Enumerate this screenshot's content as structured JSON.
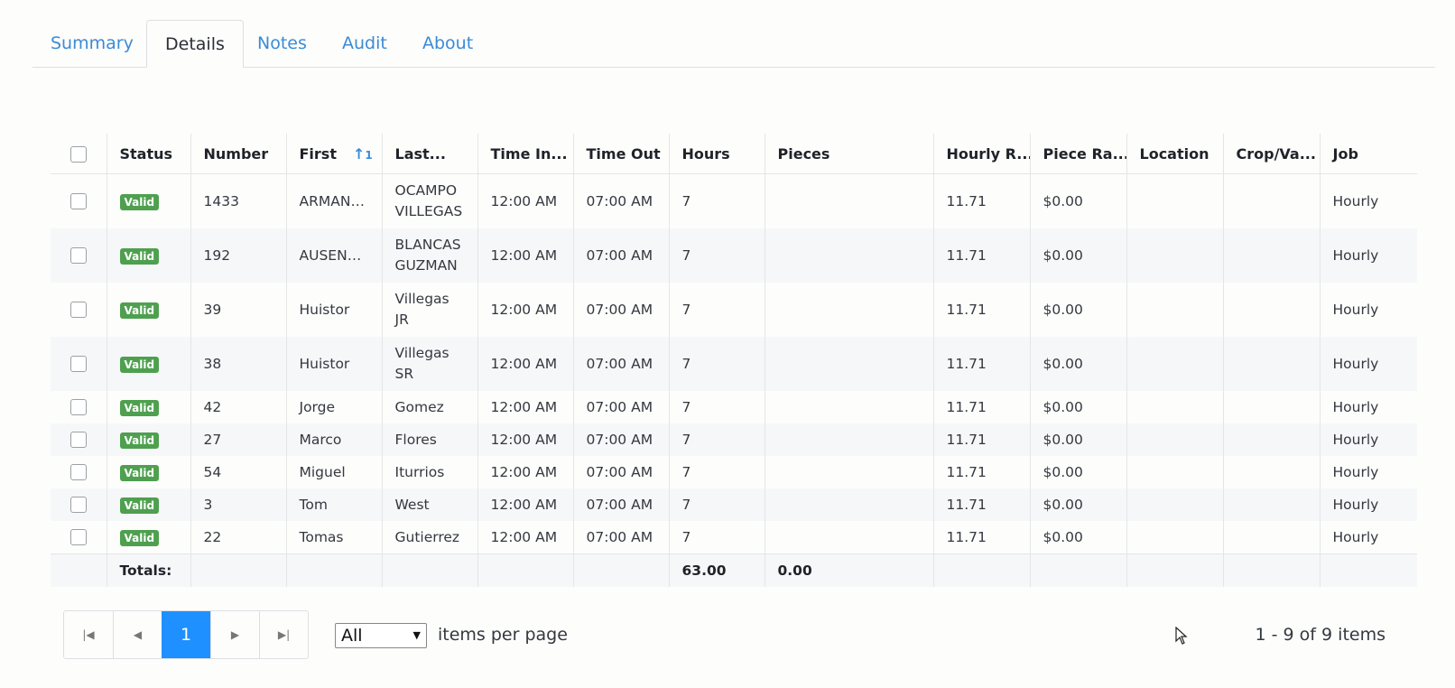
{
  "tabs": [
    {
      "label": "Summary",
      "active": false
    },
    {
      "label": "Details",
      "active": true
    },
    {
      "label": "Notes",
      "active": false
    },
    {
      "label": "Audit",
      "active": false
    },
    {
      "label": "About",
      "active": false
    }
  ],
  "grid": {
    "columns": [
      "Status",
      "Number",
      "First",
      "Last...",
      "Time In...",
      "Time Out",
      "Hours",
      "Pieces",
      "Hourly R...",
      "Piece Ra...",
      "Location",
      "Crop/Va...",
      "Job"
    ],
    "sort": {
      "column": "First",
      "direction": "ascending",
      "order": "1"
    },
    "rows": [
      {
        "status": "Valid",
        "number": "1433",
        "first": "ARMAND...",
        "last": [
          "OCAMPO",
          "VILLEGAS"
        ],
        "time_in": "12:00 AM",
        "time_out": "07:00 AM",
        "hours": "7",
        "pieces": "",
        "hourly_rate": "11.71",
        "piece_rate": "$0.00",
        "location": "",
        "crop": "",
        "job": "Hourly"
      },
      {
        "status": "Valid",
        "number": "192",
        "first": "AUSENCI...",
        "last": [
          "BLANCAS",
          "GUZMAN"
        ],
        "time_in": "12:00 AM",
        "time_out": "07:00 AM",
        "hours": "7",
        "pieces": "",
        "hourly_rate": "11.71",
        "piece_rate": "$0.00",
        "location": "",
        "crop": "",
        "job": "Hourly"
      },
      {
        "status": "Valid",
        "number": "39",
        "first": "Huistor",
        "last": [
          "Villegas",
          "JR"
        ],
        "time_in": "12:00 AM",
        "time_out": "07:00 AM",
        "hours": "7",
        "pieces": "",
        "hourly_rate": "11.71",
        "piece_rate": "$0.00",
        "location": "",
        "crop": "",
        "job": "Hourly"
      },
      {
        "status": "Valid",
        "number": "38",
        "first": "Huistor",
        "last": [
          "Villegas",
          "SR"
        ],
        "time_in": "12:00 AM",
        "time_out": "07:00 AM",
        "hours": "7",
        "pieces": "",
        "hourly_rate": "11.71",
        "piece_rate": "$0.00",
        "location": "",
        "crop": "",
        "job": "Hourly"
      },
      {
        "status": "Valid",
        "number": "42",
        "first": "Jorge",
        "last": [
          "Gomez"
        ],
        "time_in": "12:00 AM",
        "time_out": "07:00 AM",
        "hours": "7",
        "pieces": "",
        "hourly_rate": "11.71",
        "piece_rate": "$0.00",
        "location": "",
        "crop": "",
        "job": "Hourly"
      },
      {
        "status": "Valid",
        "number": "27",
        "first": "Marco",
        "last": [
          "Flores"
        ],
        "time_in": "12:00 AM",
        "time_out": "07:00 AM",
        "hours": "7",
        "pieces": "",
        "hourly_rate": "11.71",
        "piece_rate": "$0.00",
        "location": "",
        "crop": "",
        "job": "Hourly"
      },
      {
        "status": "Valid",
        "number": "54",
        "first": "Miguel",
        "last": [
          "Iturrios"
        ],
        "time_in": "12:00 AM",
        "time_out": "07:00 AM",
        "hours": "7",
        "pieces": "",
        "hourly_rate": "11.71",
        "piece_rate": "$0.00",
        "location": "",
        "crop": "",
        "job": "Hourly"
      },
      {
        "status": "Valid",
        "number": "3",
        "first": "Tom",
        "last": [
          "West"
        ],
        "time_in": "12:00 AM",
        "time_out": "07:00 AM",
        "hours": "7",
        "pieces": "",
        "hourly_rate": "11.71",
        "piece_rate": "$0.00",
        "location": "",
        "crop": "",
        "job": "Hourly"
      },
      {
        "status": "Valid",
        "number": "22",
        "first": "Tomas",
        "last": [
          "Gutierrez"
        ],
        "time_in": "12:00 AM",
        "time_out": "07:00 AM",
        "hours": "7",
        "pieces": "",
        "hourly_rate": "11.71",
        "piece_rate": "$0.00",
        "location": "",
        "crop": "",
        "job": "Hourly"
      }
    ],
    "totals": {
      "label": "Totals:",
      "hours": "63.00",
      "pieces": "0.00"
    }
  },
  "pager": {
    "current_page": "1",
    "page_size_value": "All",
    "items_per_page_label": "items per page",
    "info": "1 - 9 of 9 items"
  },
  "icons": {
    "first": "first-page-icon",
    "prev": "previous-page-icon",
    "next": "next-page-icon",
    "last": "last-page-icon",
    "sort": "sort-ascending-icon",
    "cursor": "mouse-pointer-icon"
  },
  "colors": {
    "accent": "#1e90ff",
    "link": "#3b8bd6",
    "valid_badge": "#4ea04f"
  }
}
